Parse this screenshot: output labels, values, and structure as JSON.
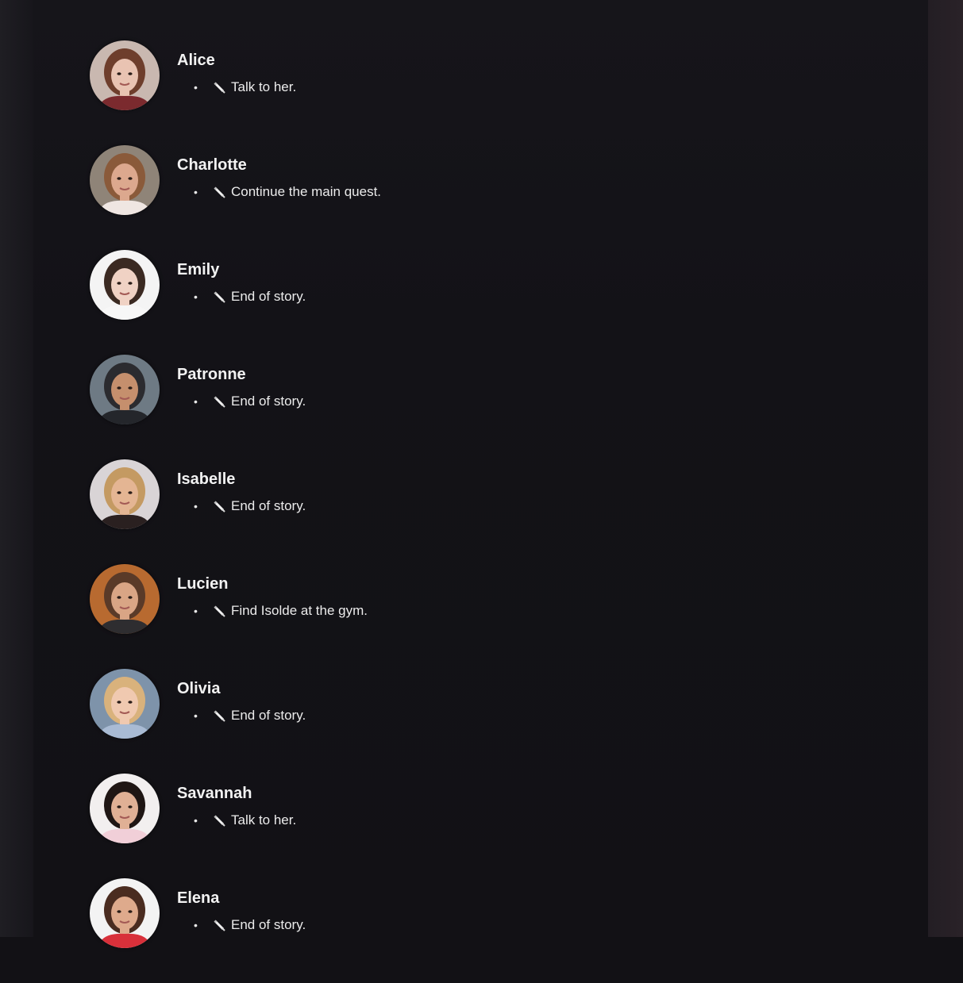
{
  "characters": [
    {
      "name": "Alice",
      "task": "Talk to her.",
      "skin": "#e9c3b2",
      "hair": "#6e3e2c",
      "bg": "#c9b8b0",
      "shirt": "#7b2a2e"
    },
    {
      "name": "Charlotte",
      "task": "Continue the main quest.",
      "skin": "#dca88e",
      "hair": "#8a5a3a",
      "bg": "#8f8478",
      "shirt": "#efe6e2"
    },
    {
      "name": "Emily",
      "task": "End of story.",
      "skin": "#f0d2c4",
      "hair": "#3b2a22",
      "bg": "#f4f4f4",
      "shirt": "#f7f7f7"
    },
    {
      "name": "Patronne",
      "task": "End of story.",
      "skin": "#c58f6d",
      "hair": "#2b2b2f",
      "bg": "#6e7a84",
      "shirt": "#24262b"
    },
    {
      "name": "Isabelle",
      "task": "End of story.",
      "skin": "#e4b593",
      "hair": "#c49a62",
      "bg": "#d9d4d6",
      "shirt": "#2a2020"
    },
    {
      "name": "Lucien",
      "task": "Find Isolde at the gym.",
      "skin": "#d9a585",
      "hair": "#5a3a28",
      "bg": "#b86a30",
      "shirt": "#2e2d30"
    },
    {
      "name": "Olivia",
      "task": "End of story.",
      "skin": "#f0c9b0",
      "hair": "#d9b27c",
      "bg": "#7e93aa",
      "shirt": "#a9bbd4"
    },
    {
      "name": "Savannah",
      "task": "Talk to her.",
      "skin": "#e0b095",
      "hair": "#1f1614",
      "bg": "#f2efef",
      "shirt": "#f1cfd8"
    },
    {
      "name": "Elena",
      "task": "End of story.",
      "skin": "#deaa8c",
      "hair": "#4a2c20",
      "bg": "#f3f3f3",
      "shirt": "#d8303a"
    }
  ],
  "icons": {
    "task_icon": "pencil-icon",
    "bullet": "•"
  }
}
